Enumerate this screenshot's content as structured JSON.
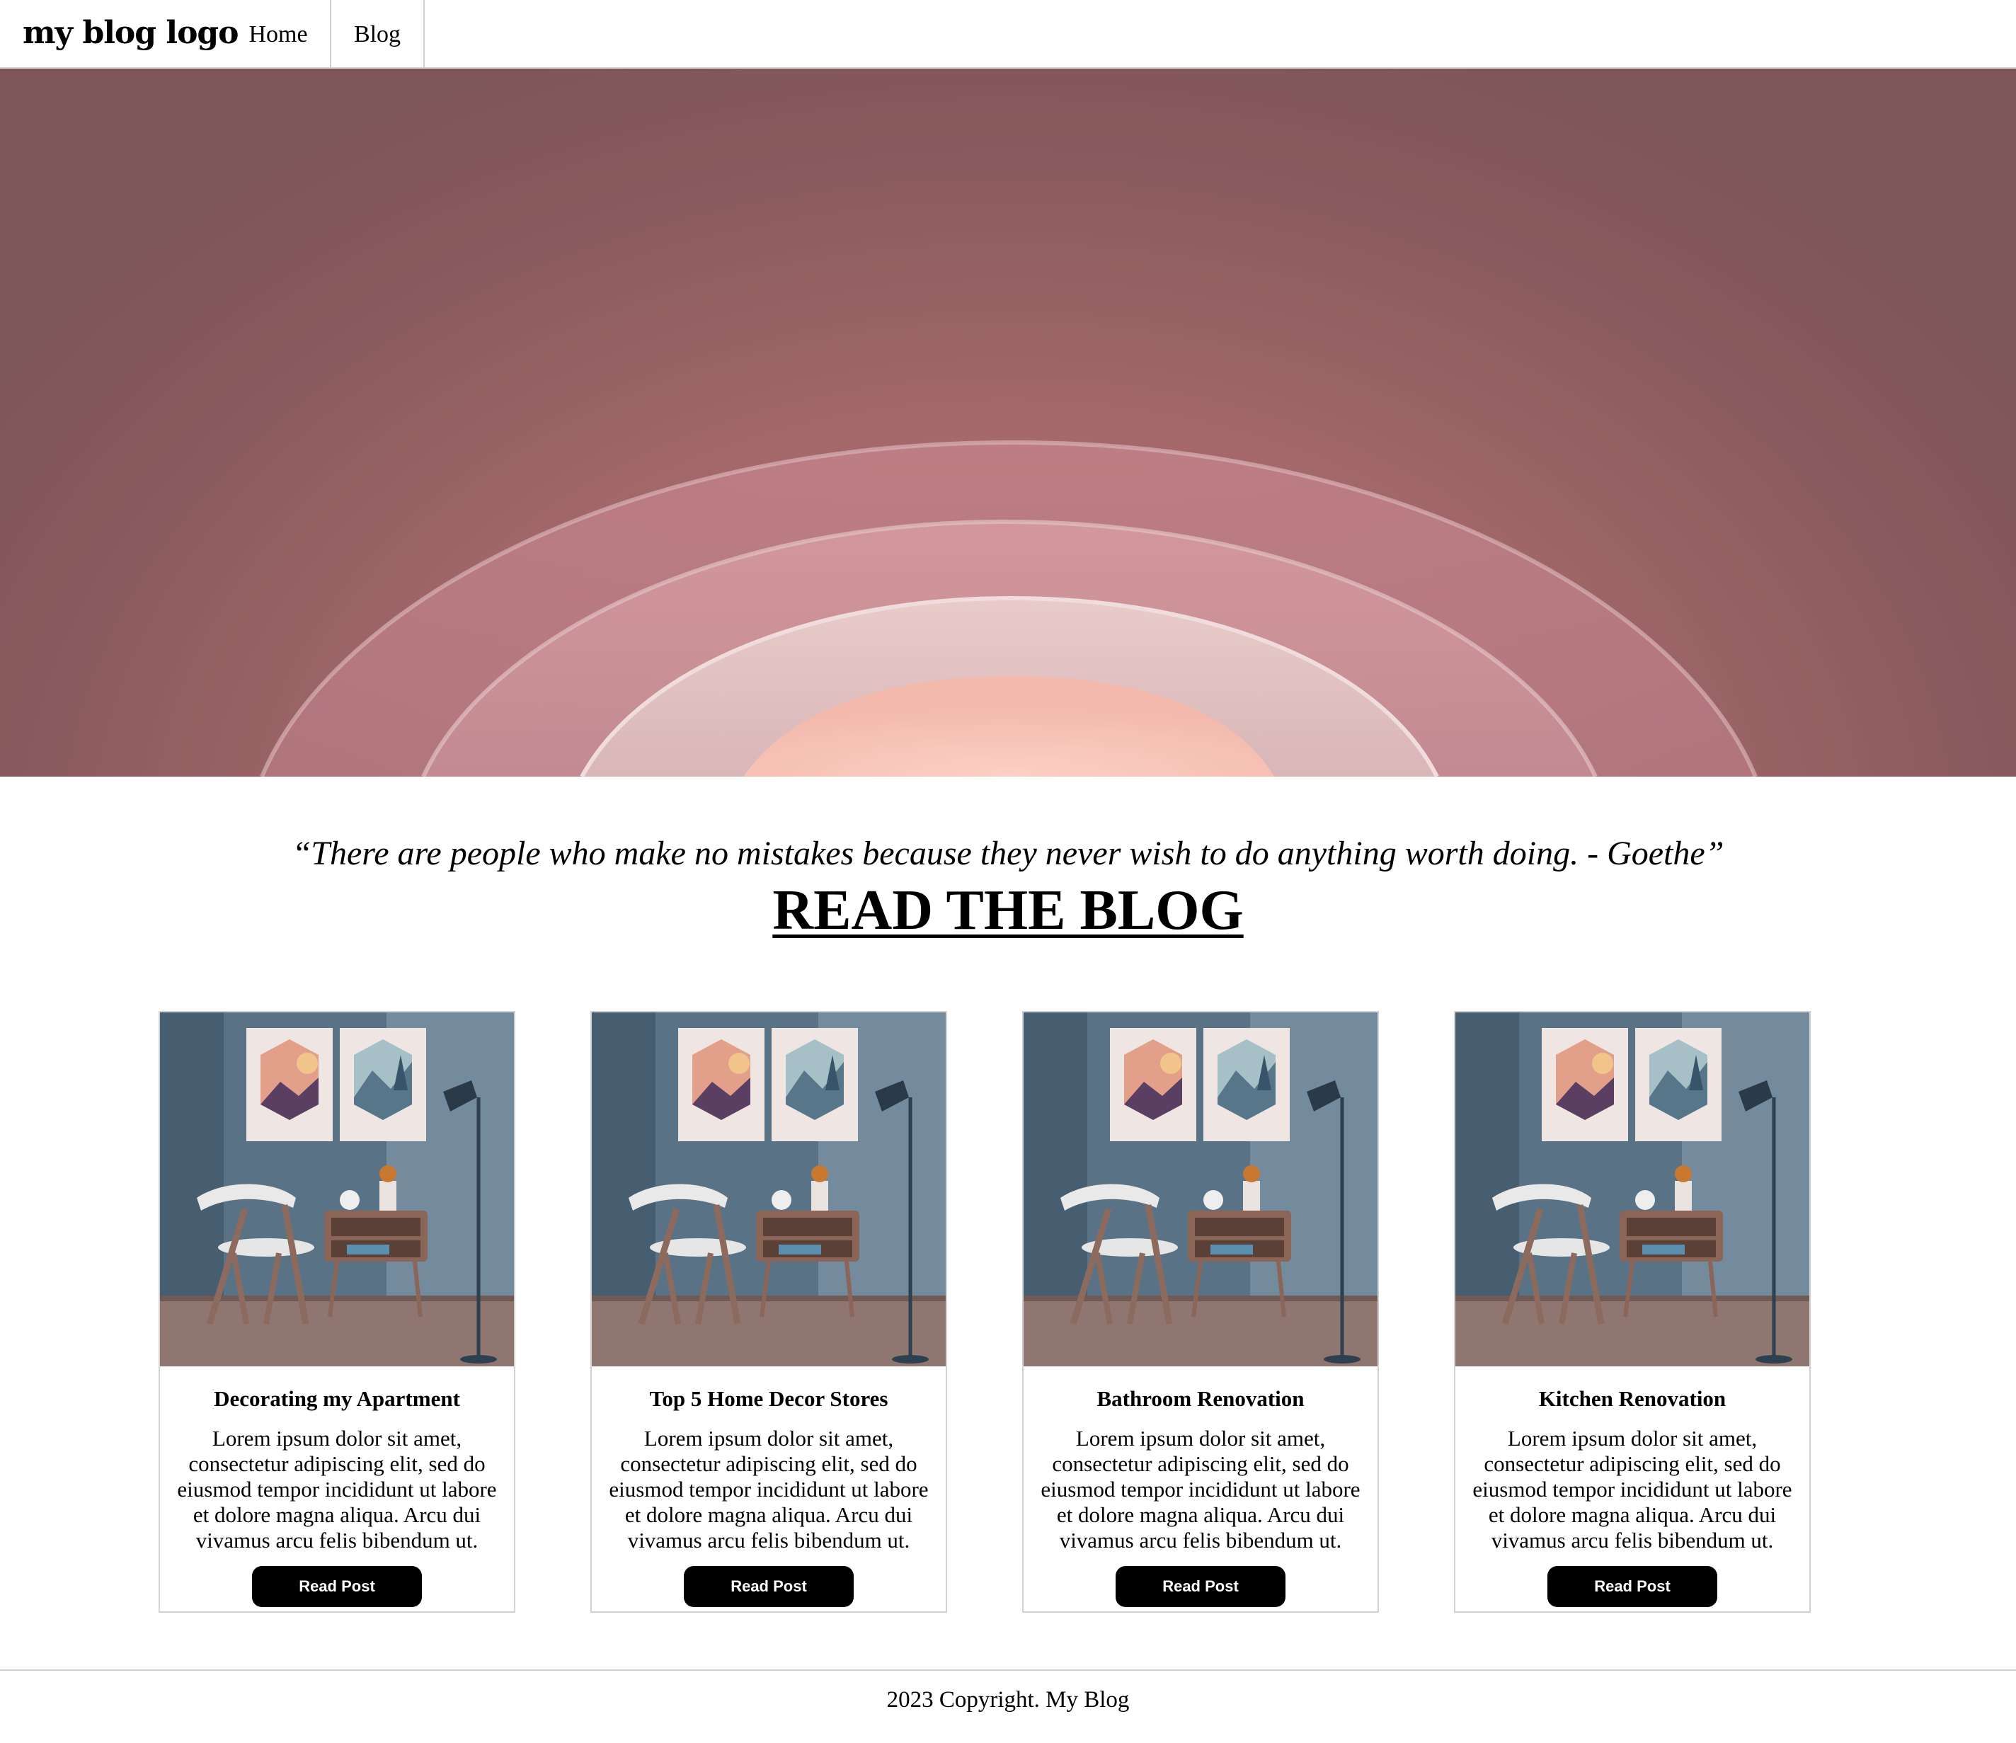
{
  "nav": {
    "logo": "my blog logo",
    "links": [
      {
        "label": "Home"
      },
      {
        "label": "Blog"
      }
    ]
  },
  "hero": {
    "image": "abstract-pink-arches-image",
    "colors": {
      "outer": "#8a5b5e",
      "mid": "#b56f75",
      "glow": "#fcd0c4"
    }
  },
  "quote": "“There are people who make no mistakes because they never wish to do anything worth doing. - Goethe”",
  "headline": "READ THE BLOG",
  "posts": [
    {
      "title": "Decorating my Apartment",
      "excerpt": "Lorem ipsum dolor sit amet, consectetur adipiscing elit, sed do eiusmod tempor incididunt ut labore et dolore magna aliqua. Arcu dui vivamus arcu felis bibendum ut.",
      "button": "Read Post",
      "image": "room-chair-shelf-lamp-image"
    },
    {
      "title": "Top 5 Home Decor Stores",
      "excerpt": "Lorem ipsum dolor sit amet, consectetur adipiscing elit, sed do eiusmod tempor incididunt ut labore et dolore magna aliqua. Arcu dui vivamus arcu felis bibendum ut.",
      "button": "Read Post",
      "image": "room-chair-shelf-lamp-image"
    },
    {
      "title": "Bathroom Renovation",
      "excerpt": "Lorem ipsum dolor sit amet, consectetur adipiscing elit, sed do eiusmod tempor incididunt ut labore et dolore magna aliqua. Arcu dui vivamus arcu felis bibendum ut.",
      "button": "Read Post",
      "image": "room-chair-shelf-lamp-image"
    },
    {
      "title": "Kitchen Renovation",
      "excerpt": "Lorem ipsum dolor sit amet, consectetur adipiscing elit, sed do eiusmod tempor incididunt ut labore et dolore magna aliqua. Arcu dui vivamus arcu felis bibendum ut.",
      "button": "Read Post",
      "image": "room-chair-shelf-lamp-image"
    }
  ],
  "footer": {
    "copyright": "2023 Copyright. My Blog"
  }
}
